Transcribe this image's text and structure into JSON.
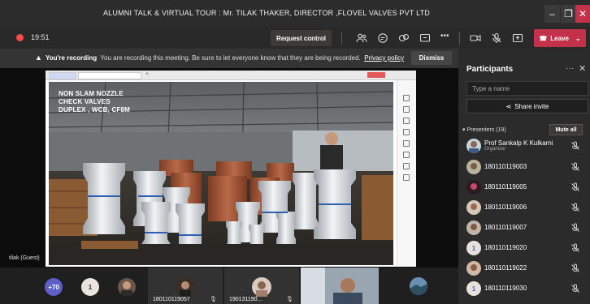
{
  "window": {
    "title": "ALUMNI TALK & VIRTUAL TOUR : Mr. TILAK THAKER, DIRECTOR ,FLOVEL VALVES PVT LTD"
  },
  "toolbar": {
    "timer": "19:51",
    "request_control": "Request control",
    "leave": "Leave",
    "icons": [
      "people-icon",
      "chat-icon",
      "reactions-icon",
      "share-tray-icon",
      "more-icon",
      "camera-off-icon",
      "mic-off-icon",
      "share-icon"
    ]
  },
  "banner": {
    "bold": "You're recording",
    "text": "You are recording this meeting. Be sure to let everyone know that they are being recorded.",
    "link": "Privacy policy",
    "dismiss": "Dismiss"
  },
  "stage": {
    "slide_lines": [
      "NON SLAM NOZZLE",
      "CHECK VALVES",
      "DUPLEX , WCB, CF8M"
    ],
    "presenter_label": "tilak (Guest)"
  },
  "strip": {
    "overflow_count": "+70",
    "single_initial": "1",
    "tiles": [
      {
        "label": "180110119057"
      },
      {
        "label": "190131190..."
      },
      {
        "label": ""
      }
    ]
  },
  "participants": {
    "title": "Participants",
    "search_placeholder": "Type a name",
    "share_invite": "Share invite",
    "presenters_header": "Presenters (19)",
    "mute_all": "Mute all",
    "people": [
      {
        "name": "Prof Sankalp K Kulkarni",
        "role": "Organizer"
      },
      {
        "name": "180110119003",
        "role": ""
      },
      {
        "name": "180110119005",
        "role": ""
      },
      {
        "name": "180110119006",
        "role": ""
      },
      {
        "name": "180110119007",
        "role": ""
      },
      {
        "name": "180110119020",
        "role": ""
      },
      {
        "name": "180110119022",
        "role": ""
      },
      {
        "name": "180110119030",
        "role": ""
      }
    ]
  },
  "colors": {
    "leave": "#c4314b",
    "recording": "#ff4a4a",
    "panel": "#2b2b2b"
  }
}
